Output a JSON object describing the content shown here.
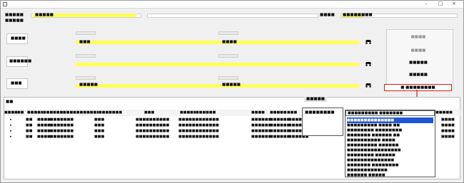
{
  "window": {
    "minimize": "–",
    "maximize": "□",
    "close": "×"
  },
  "top": {
    "left_label": "■■■■■",
    "left_value": "■■■■■",
    "right_label": "■■■■",
    "right_value": "■■■■■■■■",
    "section_label": "■■■■■"
  },
  "form": {
    "rows": [
      {
        "label": "■■■■",
        "value1": "■■■",
        "value2": "■■■■"
      },
      {
        "label": "■■■■■■",
        "value1": "",
        "value2": ""
      },
      {
        "label": "■■■",
        "value1": "■■■■■",
        "value2": "■■■■■"
      }
    ]
  },
  "buttons": {
    "b1": "■■■■",
    "b2": "■■■■",
    "b3": "■■■■■",
    "b4": "■■■■■",
    "b5": "■ ■■■■■■■■"
  },
  "panel": {
    "label": "■■",
    "tab": "■■■■■"
  },
  "table": {
    "headers": [
      "■■■■■",
      "■■",
      "■■■■■■",
      "■■■■■■■",
      "■■■■■■■■■■■■",
      "■■■■■■■",
      "■■■",
      "■■■■■■■",
      "■■■■■■",
      "■■■■",
      "■■■■■■",
      "■■■",
      "■■■■■■",
      "■■■■",
      "■■■■■■■■"
    ],
    "rows": [
      [
        "■■",
        "■■■■",
        "■■■■■■■",
        "■■■",
        "■■■■■■■■■■",
        "■■■■■■■■■■■■",
        "■■■■■■",
        "■■■■■■",
        "■■■■■■",
        "■■■",
        "■■■■■■■",
        "■■■■"
      ],
      [
        "■■",
        "■■■■",
        "■■■■■■■",
        "■■■",
        "■■■■■■■■■■",
        "■■■■■■■■■■■■",
        "■■■■■■",
        "■■■■■■",
        "■■■■■■",
        "■■■",
        "■■■■■■■",
        "■■■■"
      ],
      [
        "■■",
        "■■■■",
        "■■■■■■■",
        "■■■",
        "■■■■■■■■■■",
        "■■■■■■■■■■■■",
        "■■■■■■",
        "■■■■■■",
        "■■■■■■",
        "■■■",
        "■■■■■■■",
        "■■■■"
      ],
      [
        "■■",
        "■■■■",
        "■■■■■■■",
        "■■■",
        "■■■■■■■■■■",
        "■■■■■■■■■■■■",
        "■■■■■■",
        "■■■■■■",
        "■■■■■■",
        "■■■",
        "■■■■■■■",
        "■■■■"
      ]
    ]
  },
  "popup": {
    "title": "■■■■■■■■"
  },
  "dropdown": {
    "selected": "■■■■■■■■■ ■■■■■■■",
    "items": [
      "■■■■■■■■■■■■■■",
      "■■■■■■■■■ ■■■■ ■■",
      "■■■■■■■■ ■■■■■■■■",
      "■■■■■■■ ■■■■■■ ■■",
      "■■■■■■■■■■ ■■■■",
      "■■■■■■■■■ ■■■■■■",
      "■■■■■■■■■■■■■■■■",
      "■■■■■■■■ ■■■■■■",
      "■■■■■■■■■■■■■■",
      "■■■■■■■ ■■■■■■■■",
      "■■■■■■■■■■■■",
      "■■■■■■ ■■■■■"
    ]
  },
  "colors": {
    "highlight": "#ffff55",
    "selection": "#1f56d6",
    "red_box": "#d62020"
  }
}
